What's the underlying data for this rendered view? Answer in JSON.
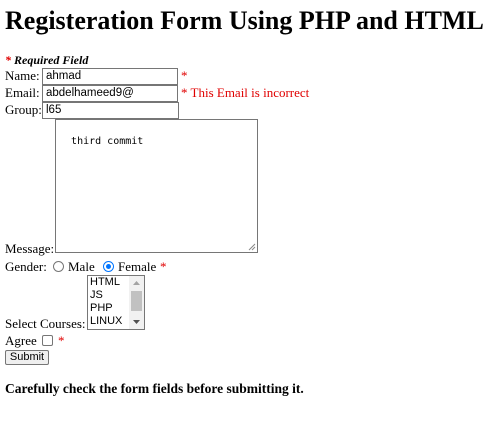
{
  "title": "Registeration Form Using PHP and HTML",
  "required_note": {
    "star": "*",
    "text": "Required Field"
  },
  "fields": {
    "name": {
      "label": "Name:",
      "value": "ahmad",
      "star": "*"
    },
    "email": {
      "label": "Email:",
      "value": "abdelhameed9@",
      "error": "* This Email is incorrect"
    },
    "group": {
      "label": "Group:",
      "value": "l65"
    },
    "message": {
      "label": "Message:",
      "value": "third commit"
    }
  },
  "gender": {
    "label": "Gender:",
    "options": [
      {
        "label": "Male",
        "selected": false
      },
      {
        "label": "Female",
        "selected": true
      }
    ],
    "star": "*"
  },
  "courses": {
    "label": "Select Courses:",
    "options": [
      "HTML",
      "JS",
      "PHP",
      "LINUX"
    ]
  },
  "agree": {
    "label": "Agree",
    "checked": false,
    "star": "*"
  },
  "submit_label": "Submit",
  "bottom_note": "Carefully check the form fields before submitting it.",
  "colors": {
    "required": "#e00000",
    "radio_selected": "#0075ff"
  }
}
